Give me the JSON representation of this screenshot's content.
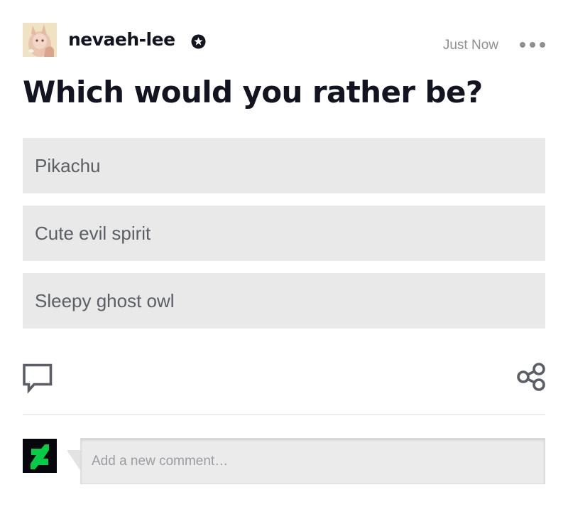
{
  "post": {
    "author": {
      "username": "nevaeh-lee",
      "badge_icon": "core-member-badge-icon"
    },
    "timestamp": "Just Now",
    "menu_icon": "more-options-icon",
    "poll": {
      "question": "Which would you rather be?",
      "options": [
        {
          "label": "Pikachu"
        },
        {
          "label": "Cute evil spirit"
        },
        {
          "label": "Sleepy ghost owl"
        }
      ]
    },
    "actions": {
      "comment_icon": "comment-bubble-icon",
      "share_icon": "share-icon"
    }
  },
  "comment_form": {
    "logo_icon": "deviantart-logo-icon",
    "placeholder": "Add a new comment…",
    "value": ""
  },
  "colors": {
    "text_primary": "#121521",
    "text_muted": "#8d8f94",
    "option_bg": "#e9e9e9",
    "brand_green": "#05cc47"
  }
}
